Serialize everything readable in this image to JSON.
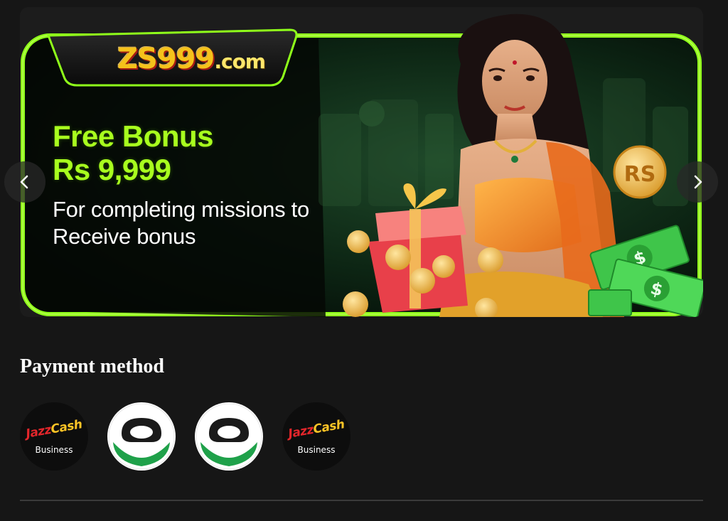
{
  "banner": {
    "logo_main": "ZS999",
    "logo_suffix": ".com",
    "headline_line1": "Free Bonus",
    "headline_line2": "Rs 9,999",
    "subline": "For completing missions to Receive bonus",
    "coin_label": "RS",
    "accent_color": "#8fff1a",
    "prev_icon": "chevron-left-icon",
    "next_icon": "chevron-right-icon"
  },
  "payment": {
    "title": "Payment method",
    "methods": [
      {
        "brand": "Jazz",
        "brand_suffix": "Cash",
        "sub": "Business",
        "icon": "jazzcash-logo"
      },
      {
        "icon": "easypaisa-logo"
      },
      {
        "icon": "easypaisa-logo"
      },
      {
        "brand": "Jazz",
        "brand_suffix": "Cash",
        "sub": "Business",
        "icon": "jazzcash-logo"
      }
    ]
  }
}
